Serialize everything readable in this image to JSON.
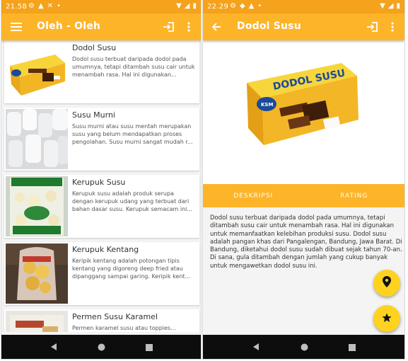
{
  "left_screen": {
    "status": {
      "time": "21.58"
    },
    "appbar": {
      "title": "Oleh - Oleh",
      "login_icon": "login-icon",
      "more_icon": "more-vert-icon",
      "menu_icon": "menu-icon"
    },
    "items": [
      {
        "title": "Dodol Susu",
        "desc": "Dodol susu terbuat daripada dodol pada umumnya, tetapi ditambah susu cair untuk menambah rasa. Hal ini digunakan..."
      },
      {
        "title": "Susu Murni",
        "desc": "Susu murni atau susu mentah merupakan susu yang belum mendapatkan proses pengolahan. Susu murni sangat mudah r..."
      },
      {
        "title": "Kerupuk Susu",
        "desc": "Kerupuk susu adalah produk serupa dengan kerupuk udang yang terbuat dari bahan dasar susu. Kerupuk semacam ini..."
      },
      {
        "title": "Kerupuk Kentang",
        "desc": "Keripik kentang adalah potongan tipis kentang yang digoreng deep fried atau dipanggang sampai garing. Keripik kent..."
      },
      {
        "title": "Permen Susu Karamel",
        "desc": "Permen karamel susu atau toppies..."
      }
    ],
    "thumb_labels": {
      "kerupuk": "KERUPUK SUSU",
      "kerupuk_brand": "SAROKAH"
    }
  },
  "right_screen": {
    "status": {
      "time": "22.29"
    },
    "appbar": {
      "title": "Dodol Susu",
      "back_icon": "arrow-back-icon",
      "login_icon": "login-icon",
      "more_icon": "more-vert-icon"
    },
    "hero_text": {
      "brand": "DODOL SUSU",
      "logo": "KSM"
    },
    "tabs": [
      {
        "label": "DESKRIPSI"
      },
      {
        "label": "RATING"
      }
    ],
    "description": "Dodol susu terbuat daripada dodol pada umumnya, tetapi ditambah susu cair untuk menambah rasa. Hal ini digunakan untuk memanfaatkan kelebihan produksi susu. Dodol susu adalah pangan khas dari Pangalengan, Bandung, Jawa Barat. Di Bandung, diketahui dodol susu sudah dibuat sejak tahun 70-an. Di sana, gula ditambah dengan jumlah yang cukup banyak untuk mengawetkan dodol susu ini.",
    "fabs": [
      {
        "icon": "location-pin-icon"
      },
      {
        "icon": "star-icon"
      }
    ]
  },
  "colors": {
    "status_bar": "#f5a21c",
    "app_bar": "#fdb429",
    "fab": "#ffd21f",
    "nav_bar": "#0d0d0d"
  }
}
